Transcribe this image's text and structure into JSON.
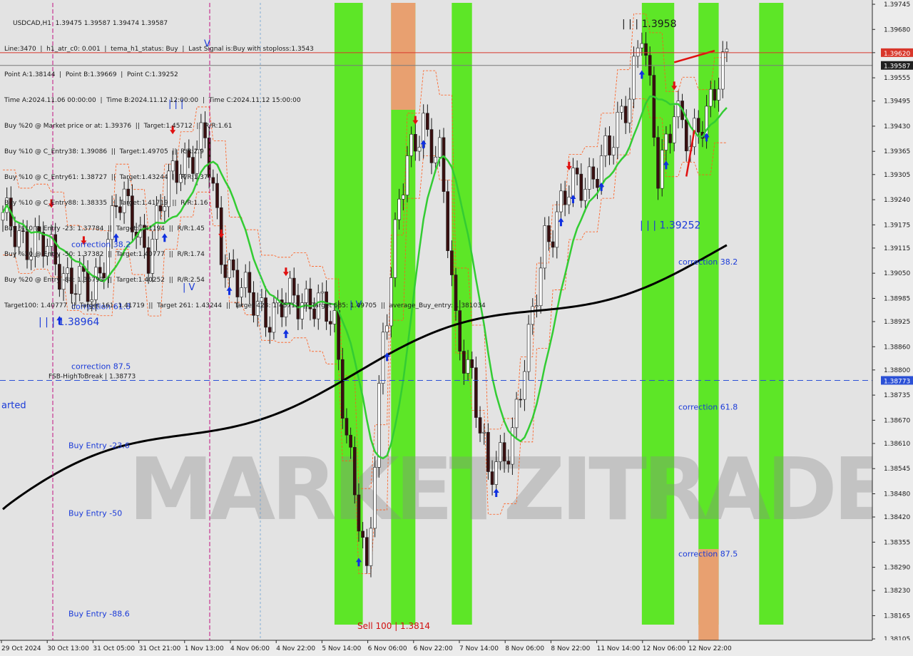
{
  "chart_data": {
    "type": "candlestick",
    "symbol_header": "USDCAD,H1  1.39475 1.39587 1.39474 1.39587",
    "info_lines": [
      "Line:3470  |  h1_atr_c0: 0.001  |  tema_h1_status: Buy  |  Last Signal is:Buy with stoploss:1.3543",
      "Point A:1.38144  |  Point B:1.39669  |  Point C:1.39252",
      "Time A:2024.11.06 00:00:00  |  Time B:2024.11.12 12:00:00  |  Time C:2024.11.12 15:00:00",
      "Buy %20 @ Market price or at: 1.39376  ||  Target:1.45712  ||  R/R:1.61",
      "Buy %10 @ C_Entry38: 1.39086  ||  Target:1.49705  ||  R/R:2.9",
      "Buy %10 @ C_Entry61: 1.38727  ||  Target:1.43244  ||  R/R:1.37",
      "Buy %10 @ C_Entry88: 1.38335  ||  Target:1.41719  ||  R/R:1.16",
      "Buy %10 @ Entry -23: 1.37784  ||  Target:1.41194  ||  R/R:1.45",
      "Buy %20 @ Entry -50: 1.37382  ||  Target:1.40777  ||  R/R:1.74",
      "Buy %20 @ Entry -88: 1.36793  ||  Target:1.40252  ||  R/R:2.54",
      "Target100: 1.40777  ||  Target 161: 1.41719  ||  Target 261: 1.43244  ||  Target 423: 1.45712  ||  Target 685: 1.49705  ||  average_Buy_entry: 1.381034"
    ],
    "y_axis": {
      "min": 1.38105,
      "max": 1.39745,
      "ticks": [
        "1.39745",
        "1.39680",
        "1.39620",
        "1.39555",
        "1.39495",
        "1.39430",
        "1.39365",
        "1.39305",
        "1.39240",
        "1.39175",
        "1.39115",
        "1.39050",
        "1.38985",
        "1.38925",
        "1.38860",
        "1.38800",
        "1.38735",
        "1.38670",
        "1.38610",
        "1.38545",
        "1.38480",
        "1.38420",
        "1.38355",
        "1.38290",
        "1.38230",
        "1.38165",
        "1.38105"
      ]
    },
    "x_axis": {
      "labels": [
        "29 Oct 2024",
        "30 Oct 13:00",
        "31 Oct 05:00",
        "31 Oct 21:00",
        "1 Nov 13:00",
        "4 Nov 06:00",
        "4 Nov 22:00",
        "5 Nov 14:00",
        "6 Nov 06:00",
        "6 Nov 22:00",
        "7 Nov 14:00",
        "8 Nov 06:00",
        "8 Nov 22:00",
        "11 Nov 14:00",
        "12 Nov 06:00",
        "12 Nov 22:00"
      ]
    },
    "price_tags": [
      {
        "value": "1.39620",
        "color": "#d8362a"
      },
      {
        "value": "1.39587",
        "color": "#202020"
      },
      {
        "value": "1.38773",
        "color": "#2b50d6"
      }
    ],
    "horizontal_lines": [
      {
        "price": 1.3962,
        "color": "#d8362a"
      },
      {
        "price": 1.39587,
        "color": "#7a7a7a"
      },
      {
        "price": 1.38773,
        "color": "#2b50d6",
        "dashed": true,
        "label": "FSB-HighToBreak  |  1.38773"
      }
    ],
    "fib_labels": [
      {
        "text": "correction 38.2",
        "price": 1.39125,
        "side": "left"
      },
      {
        "text": "correction 61.8",
        "price": 1.38965,
        "side": "left"
      },
      {
        "text": "correction 87.5",
        "price": 1.3881,
        "side": "left"
      },
      {
        "text": "correction 38.2",
        "price": 1.3908,
        "side": "right"
      },
      {
        "text": "correction 61.8",
        "price": 1.38705,
        "side": "right"
      },
      {
        "text": "correction 87.5",
        "price": 1.38325,
        "side": "right"
      },
      {
        "text": "Buy Entry -23.6",
        "price": 1.38605,
        "side": "left"
      },
      {
        "text": "Buy Entry -50",
        "price": 1.3843,
        "side": "left"
      },
      {
        "text": "Buy Entry -88.6",
        "price": 1.3817,
        "side": "left"
      }
    ],
    "wave_labels": [
      {
        "text": "| | | 1.38964",
        "price": 1.38925
      },
      {
        "text": "| | | 1.39252",
        "price": 1.39175
      },
      {
        "text": "| | | 1.3958",
        "price": 1.39695
      },
      {
        "text": "| V",
        "price": 1.3897
      },
      {
        "text": "| | |",
        "price": 1.3949
      },
      {
        "text": "V",
        "price": 1.39645
      },
      {
        "text": "| V",
        "price": 1.39015
      },
      {
        "text": "arted",
        "price": 1.3871
      },
      {
        "text": "Sell 100  |  1.3814",
        "price": 1.3814
      }
    ],
    "watermark": "MARKETZITRADE",
    "colors": {
      "background": "#e3e3e3",
      "bull_body": "#ffffff",
      "bear_body": "#3a0f10",
      "wick": "#1a1a1a",
      "sma_green": "#33cc33",
      "ma_black": "#000000",
      "envelope": "#ff5a1a",
      "band_green": "#55e61c",
      "band_orange": "#e8a070",
      "buy_arrow": "#1030e0",
      "sell_arrow": "#e01010"
    }
  }
}
